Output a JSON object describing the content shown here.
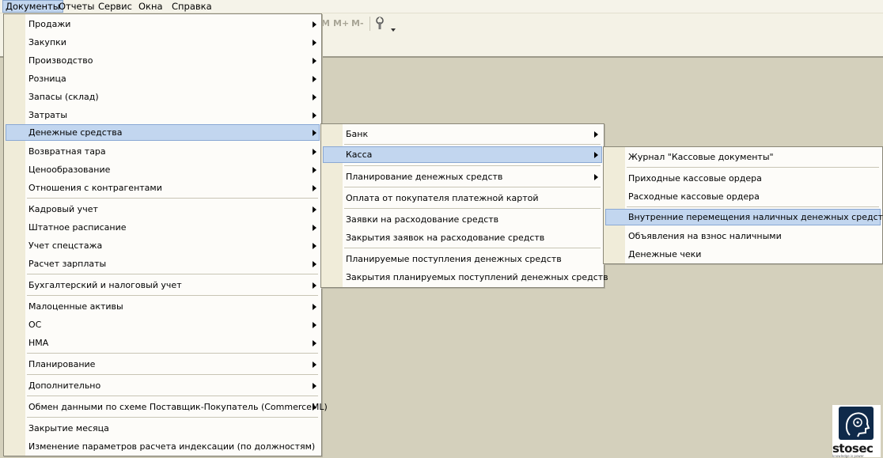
{
  "menubar": {
    "items": [
      "Документы",
      "Отчеты",
      "Сервис",
      "Окна",
      "Справка"
    ]
  },
  "toolbar": {
    "m_plus": "M+",
    "m_minus": "M-",
    "m_cut": "M",
    "icons": [
      "wrench-icon",
      "chevron-down-icon"
    ]
  },
  "documents_menu": {
    "items": [
      "Продажи",
      "Закупки",
      "Производство",
      "Розница",
      "Запасы (склад)",
      "Затраты",
      "Денежные средства",
      "Возвратная тара",
      "Ценообразование",
      "Отношения с контрагентами",
      "Кадровый учет",
      "Штатное расписание",
      "Учет спецстажа",
      "Расчет зарплаты",
      "Бухгалтерский и налоговый учет",
      "Малоценные активы",
      "ОС",
      "НМА",
      "Планирование",
      "Дополнительно",
      "Обмен данными по схеме Поставщик-Покупатель (CommerceML)",
      "Закрытие месяца",
      "Изменение параметров расчета индексации (по должностям)"
    ],
    "highlighted": "Денежные средства"
  },
  "money_menu": {
    "items": [
      "Банк",
      "Касса",
      "Планирование денежных средств",
      "Оплата от покупателя платежной картой",
      "Заявки на расходование средств",
      "Закрытия заявок на расходование средств",
      "Планируемые поступления денежных средств",
      "Закрытия планируемых поступлений денежных средств"
    ],
    "highlighted": "Касса"
  },
  "cash_menu": {
    "items": [
      "Журнал \"Кассовые документы\"",
      "Приходные кассовые ордера",
      "Расходные кассовые ордера",
      "Внутренние перемещения наличных денежных средств",
      "Объявления на взнос наличными",
      "Денежные чеки"
    ],
    "highlighted": "Внутренние перемещения наличных денежных средств"
  },
  "logo": {
    "word": "stosec",
    "tag": "knowledge is power"
  },
  "colors": {
    "highlight": "#c2d6ef",
    "background": "#d4d0bc",
    "gutter": "#f0ecd9"
  }
}
